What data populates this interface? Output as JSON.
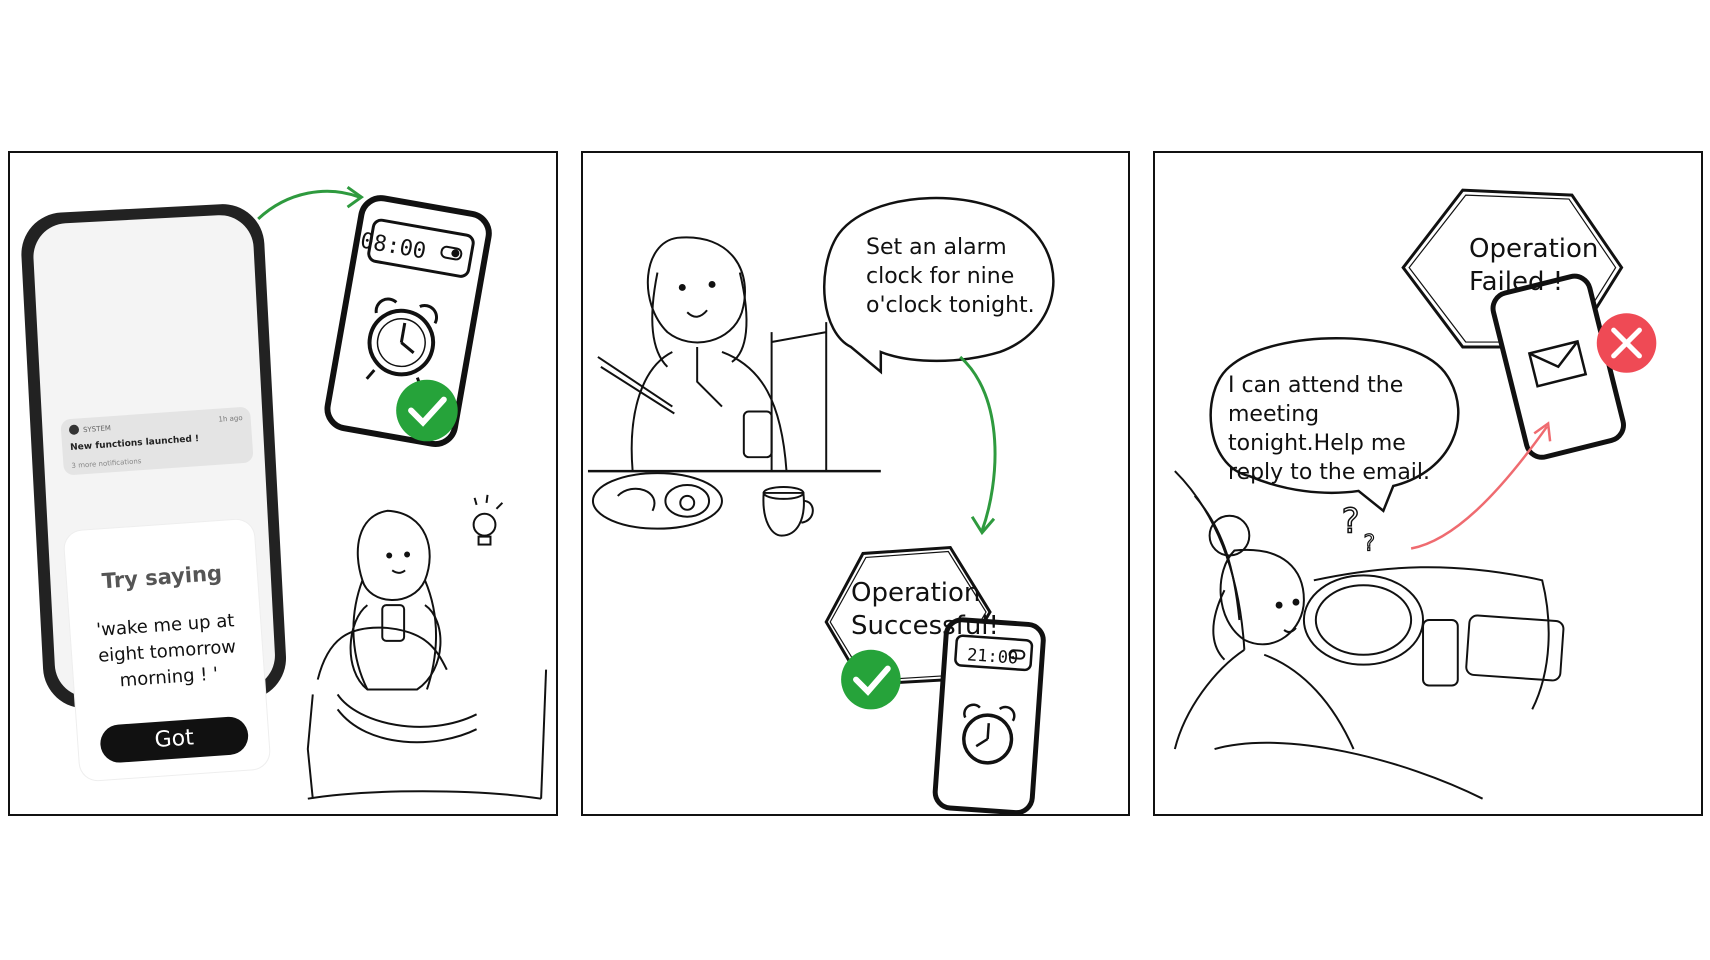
{
  "panel1": {
    "notification": {
      "source": "SYSTEM",
      "time": "1h ago",
      "message": "New functions launched !",
      "more": "3 more notifications"
    },
    "card": {
      "title": "Try saying",
      "phrase": "'wake me up at eight tomorrow morning ! '",
      "button": "Got"
    },
    "alarm_phone_time": "08:00"
  },
  "panel2": {
    "speech": "Set an alarm clock for nine o'clock tonight.",
    "result": "Operation Successful!",
    "alarm_phone_time": "21:00"
  },
  "panel3": {
    "speech": "I can attend the meeting tonight.Help me reply to the email.",
    "result": "Operation Failed !"
  },
  "colors": {
    "success": "#26a33a",
    "failure": "#ef4a55",
    "arrow_green": "#2e9a3e",
    "arrow_red": "#ef6b70",
    "ink": "#111111"
  }
}
